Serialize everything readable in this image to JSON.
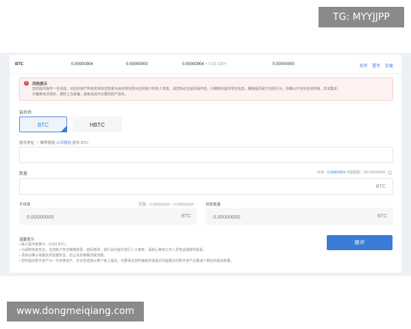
{
  "watermarks": {
    "top": "TG: MYYJJPP",
    "bottom": "www.dongmeiqiang.com"
  },
  "balance_row": {
    "coin": "BTC",
    "values": [
      "0.00000904",
      "0.00000000",
      "0.00000904",
      "0.00000000"
    ],
    "cny": "≈ 0.01 CNY",
    "actions": [
      "充币",
      "提币",
      "交易"
    ]
  },
  "risk": {
    "icon": "alert-icon",
    "title": "风险提示",
    "line1": "您的提币操作一旦完成，对应的资产所有权将由您变更为目标地址所对应的账户所有人享有。请您务必在提币操作前，仔细核对提币地址信息，确保提币属于自愿行为，并确认不涉及任何传销、非法集资、",
    "line2": "诈骗等违法情形，谨防上当受骗，避免造成不必要的财产损失。"
  },
  "chain": {
    "label": "链名称",
    "options": [
      "BTC",
      "HBTC"
    ],
    "selected": "BTC",
    "check": "✓"
  },
  "address": {
    "label": "提币地址",
    "sep": "|",
    "hint_pre": "推荐使用",
    "hint_wallet": "火币钱包",
    "hint_post": "提币 BTC",
    "value": ""
  },
  "amount": {
    "label": "数量",
    "available_label": "可用：",
    "available_value": "0.00000904",
    "limit_label": "可提额度：",
    "limit_value": "200.00000000",
    "info_icon": "i",
    "unit": "BTC",
    "value": ""
  },
  "fee": {
    "label": "手续费",
    "range": "范围：0.00050000 – 0.00050000",
    "value": "0.00050000",
    "unit": "BTC"
  },
  "received": {
    "label": "到账数量",
    "value": "0.00000000",
    "unit": "BTC"
  },
  "submit_label": "提币",
  "tips": {
    "title": "温馨提示",
    "items": [
      "• 最小提币数量为：0.001 BTC。",
      "• 为保障资金安全，当您账户安全策略变更、密码修改、我们会对提币进行人工审核，请耐心等待工作人员电话或邮件联系。",
      "• 请务必确认电脑及浏览器安全，防止信息被篡改或泄露。",
      "• 您所提的数字资产为一币多链资产，无论您选择从哪个链上提出，均要保证您所拥有的该提币页面展示的数字资产总量减少相应的提出数量。"
    ]
  }
}
